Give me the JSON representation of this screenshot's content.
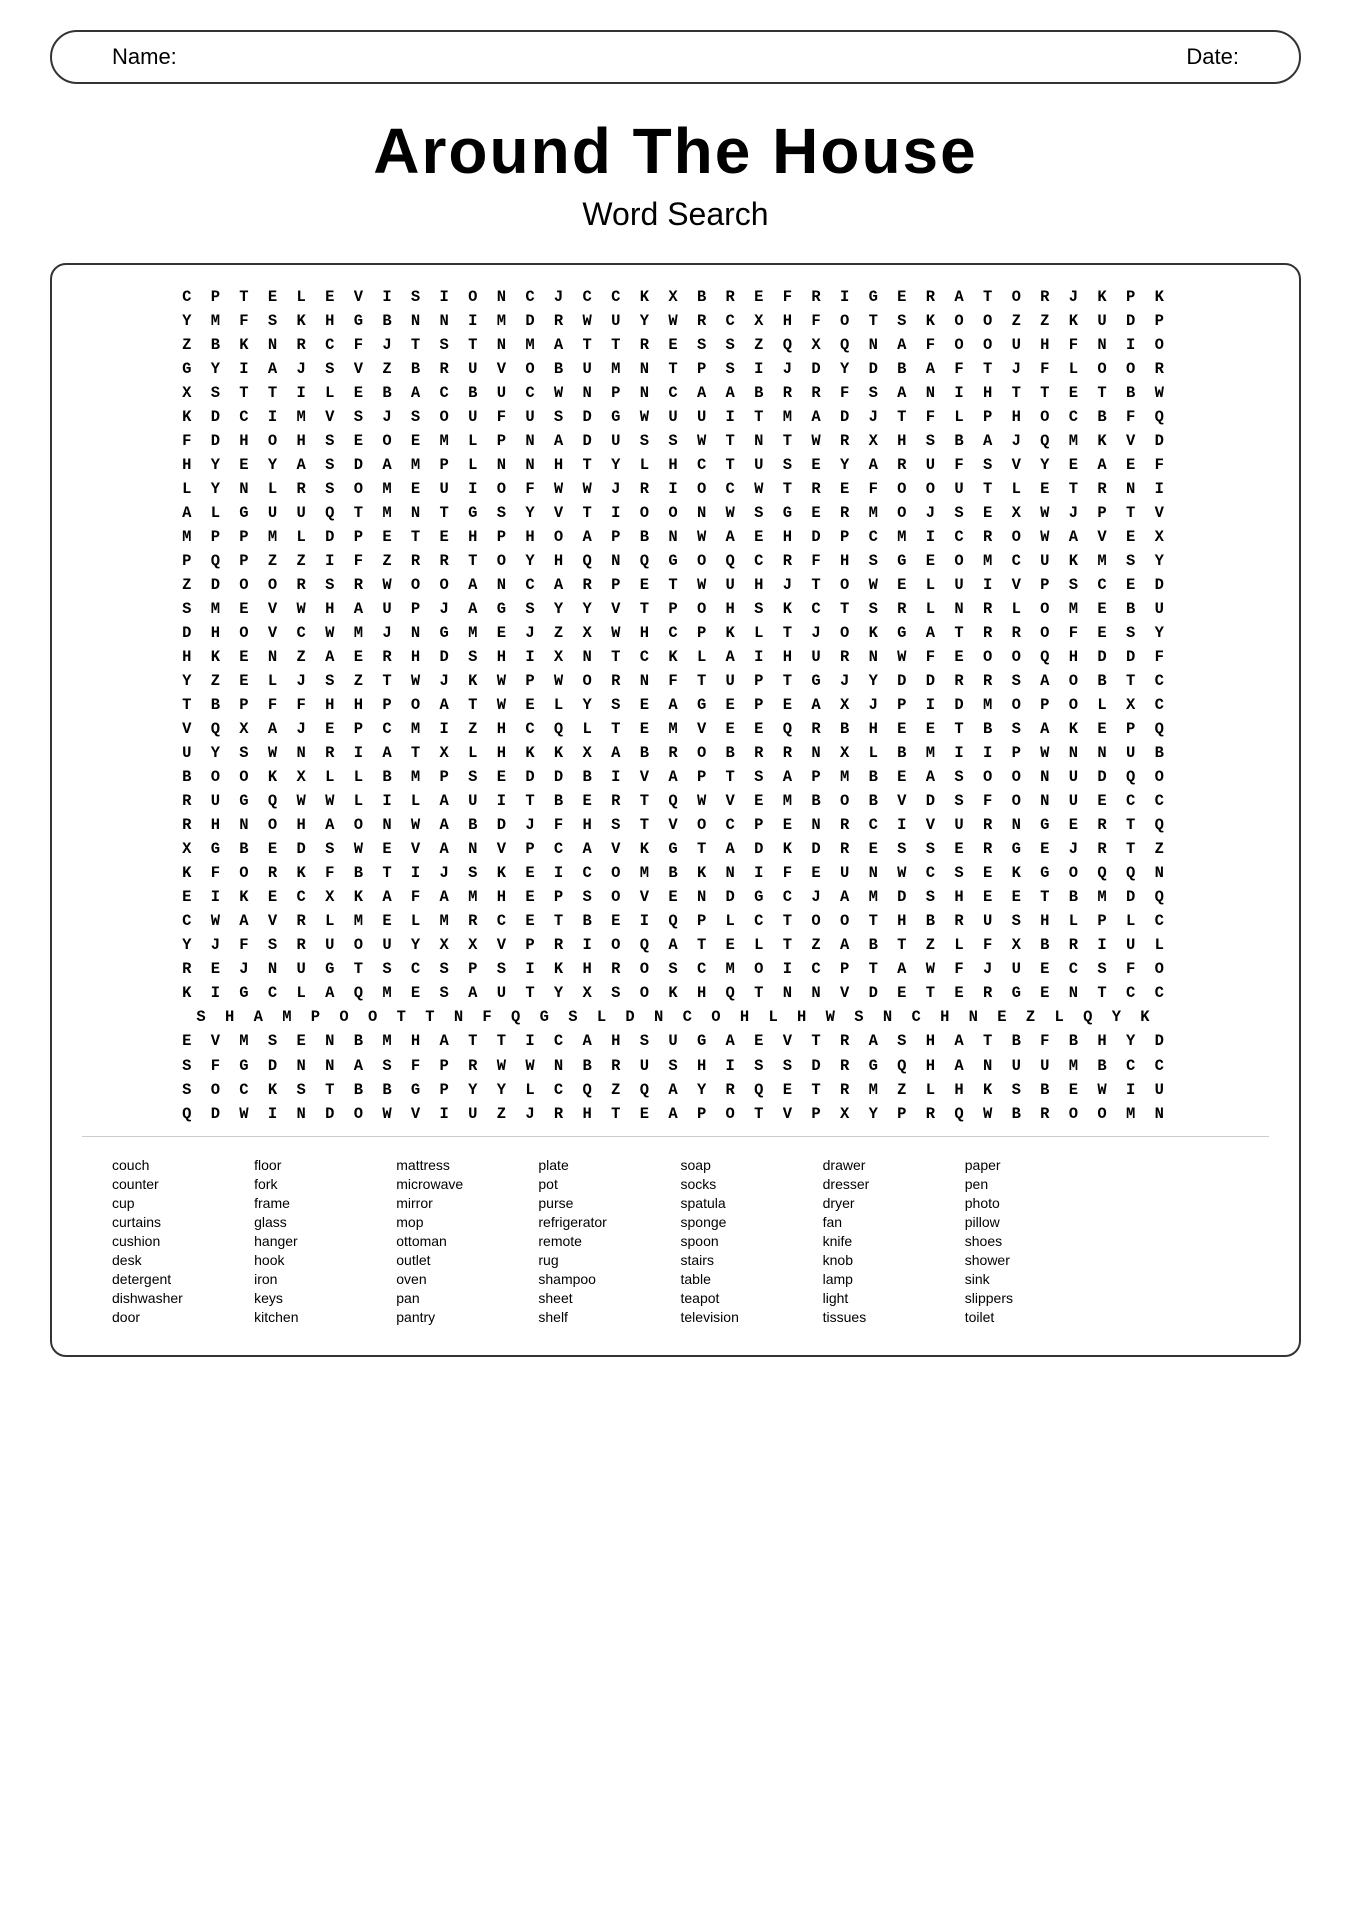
{
  "header": {
    "name_label": "Name:",
    "date_label": "Date:"
  },
  "title": {
    "main": "Around The House",
    "sub": "Word Search"
  },
  "grid_rows": [
    "C P T E L E V I S I O N C J C C K X B R E F R I G E R A T O R J K P K",
    "Y M F S K H G B N N I M D R W U Y W R C X H F O T S K O O Z Z K U D P",
    "Z B K N R C F J T S T N M A T T R E S S Z Q X Q N A F O O U H F N I O",
    "G Y I A J S V Z B R U V O B U M N T P S I J D Y D B A F T J F L O O R",
    "X S T T I L E B A C B U C W N P N C A A B R R F S A N I H T T E T B W",
    "K D C I M V S J S O U F U S D G W U U I T M A D J T F L P H O C B F Q",
    "F D H O H S E O E M L P N A D U S S W T N T W R X H S B A J Q M K V D",
    "H Y E Y A S D A M P L N N H T Y L H C T U S E Y A R U F S V Y E A E F",
    "L Y N L R S O M E U I O F W W J R I O C W T R E F O O U T L E T R N I",
    "A L G U U Q T M N T G S Y V T I O O N W S G E R M O J S E X W J P T V",
    "M P P M L D P E T E H P H O A P B N W A E H D P C M I C R O W A V E X",
    "P Q P Z Z I F Z R R T O Y H Q N Q G O Q C R F H S G E O M C U K M S Y",
    "Z D O O R S R W O O A N C A R P E T W U H J T O W E L U I V P S C E D",
    "S M E V W H A U P J A G S Y Y V T P O H S K C T S R L N R L O M E B U",
    "D H O V C W M J N G M E J Z X W H C P K L T J O K G A T R R O F E S Y",
    "H K E N Z A E R H D S H I X N T C K L A I H U R N W F E O O Q H D D F",
    "Y Z E L J S Z T W J K W P W O R N F T U P T G J Y D D R R S A O B T C",
    "T B P F F H H P O A T W E L Y S E A G E P E A X J P I D M O P O L X C",
    "V Q X A J E P C M I Z H C Q L T E M V E E Q R B H E E T B S A K E P Q",
    "U Y S W N R I A T X L H K K X A B R O B R R N X L B M I I P W N N U B",
    "B O O K X L L B M P S E D D B I V A P T S A P M B E A S O O N U D Q O",
    "R U G Q W W L I L A U I T B E R T Q W V E M B O B V D S F O N U E C C",
    "R H N O H A O N W A B D J F H S T V O C P E N R C I V U R N G E R T Q",
    "X G B E D S W E V A N V P C A V K G T A D K D R E S S E R G E J R T Z",
    "K F O R K F B T I J S K E I C O M B K N I F E U N W C S E K G O Q Q N",
    "E I K E C X K A F A M H E P S O V E N D G C J A M D S H E E T B M D Q",
    "C W A V R L M E L M R C E T B E I Q P L C T O O T H B R U S H L P L C",
    "Y J F S R U O U Y X X V P R I O Q A T E L T Z A B T Z L F X B R I U L",
    "R E J N U G T S C S P S I K H R O S C M O I C P T A W F J U E C S F O",
    "K I G C L A Q M E S A U T Y X S O K H Q T N N V D E T E R G E N T C C",
    "S H A M P O O T T N F Q G S L D N C O H L H W S N C H N E Z L Q Y K",
    "E V M S E N B M H A T T I C A H S U G A E V T R A S H A T B F B H Y D",
    "S F G D N N A S F P R W W N B R U S H I S S D R G Q H A N U U M B C C",
    "S O C K S T B B G P Y Y L C Q Z Q A Y R Q E T R M Z L H K S B E W I U",
    "Q D W I N D O W V I U Z J R H T E A P O T V P X Y P R Q W B R O O M N"
  ],
  "word_columns": [
    [
      "couch",
      "counter",
      "cup",
      "curtains",
      "cushion",
      "desk",
      "detergent",
      "dishwasher",
      "door"
    ],
    [
      "floor",
      "fork",
      "frame",
      "glass",
      "hanger",
      "hook",
      "iron",
      "keys",
      "kitchen"
    ],
    [
      "mattress",
      "microwave",
      "mirror",
      "mop",
      "ottoman",
      "outlet",
      "oven",
      "pan",
      "pantry"
    ],
    [
      "plate",
      "pot",
      "purse",
      "refrigerator",
      "remote",
      "rug",
      "shampoo",
      "sheet",
      "shelf"
    ],
    [
      "soap",
      "socks",
      "spatula",
      "sponge",
      "spoon",
      "stairs",
      "table",
      "teapot",
      "television"
    ],
    [
      "drawer",
      "dresser",
      "dryer",
      "fan",
      "knife",
      "knob",
      "lamp",
      "light",
      "tissues"
    ],
    [
      "paper",
      "pen",
      "photo",
      "pillow",
      "shoes",
      "shower",
      "sink",
      "slippers",
      "toilet"
    ]
  ]
}
